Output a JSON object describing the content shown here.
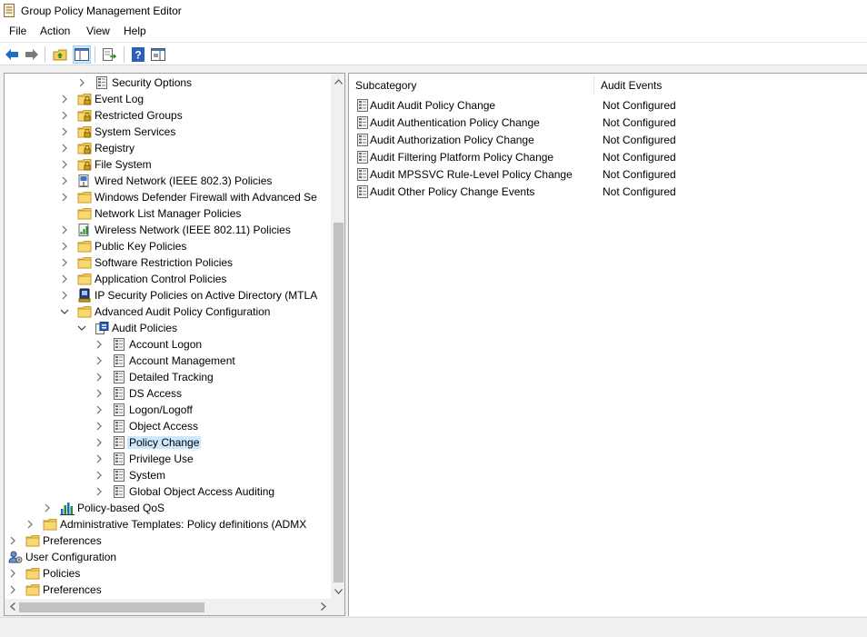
{
  "window": {
    "title": "Group Policy Management Editor"
  },
  "menu": [
    "File",
    "Action",
    "View",
    "Help"
  ],
  "toolbar": {
    "buttons": [
      "back-icon",
      "forward-icon",
      "up-folder-icon",
      "show-hide-tree-icon",
      "export-list-icon",
      "help-icon",
      "properties-pane-icon"
    ]
  },
  "tree": {
    "items": [
      {
        "label": "Security Options",
        "icon": "policy-doc-icon",
        "indent": 4,
        "expander": "collapsed"
      },
      {
        "label": "Event Log",
        "icon": "folder-lock-icon",
        "indent": 3,
        "expander": "collapsed"
      },
      {
        "label": "Restricted Groups",
        "icon": "folder-lock-icon",
        "indent": 3,
        "expander": "collapsed"
      },
      {
        "label": "System Services",
        "icon": "folder-lock-icon",
        "indent": 3,
        "expander": "collapsed"
      },
      {
        "label": "Registry",
        "icon": "folder-lock-icon",
        "indent": 3,
        "expander": "collapsed"
      },
      {
        "label": "File System",
        "icon": "folder-lock-icon",
        "indent": 3,
        "expander": "collapsed"
      },
      {
        "label": "Wired Network (IEEE 802.3) Policies",
        "icon": "wired-network-icon",
        "indent": 3,
        "expander": "collapsed"
      },
      {
        "label": "Windows Defender Firewall with Advanced Se",
        "icon": "folder-icon",
        "indent": 3,
        "expander": "collapsed"
      },
      {
        "label": "Network List Manager Policies",
        "icon": "folder-icon",
        "indent": 3,
        "expander": "none"
      },
      {
        "label": "Wireless Network (IEEE 802.11) Policies",
        "icon": "wireless-network-icon",
        "indent": 3,
        "expander": "collapsed"
      },
      {
        "label": "Public Key Policies",
        "icon": "folder-icon",
        "indent": 3,
        "expander": "collapsed"
      },
      {
        "label": "Software Restriction Policies",
        "icon": "folder-icon",
        "indent": 3,
        "expander": "collapsed"
      },
      {
        "label": "Application Control Policies",
        "icon": "folder-icon",
        "indent": 3,
        "expander": "collapsed"
      },
      {
        "label": "IP Security Policies on Active Directory (MTLA",
        "icon": "ip-security-icon",
        "indent": 3,
        "expander": "collapsed"
      },
      {
        "label": "Advanced Audit Policy Configuration",
        "icon": "folder-icon",
        "indent": 3,
        "expander": "expanded"
      },
      {
        "label": "Audit Policies",
        "icon": "audit-policies-icon",
        "indent": 4,
        "expander": "expanded"
      },
      {
        "label": "Account Logon",
        "icon": "policy-doc-icon",
        "indent": 5,
        "expander": "collapsed"
      },
      {
        "label": "Account Management",
        "icon": "policy-doc-icon",
        "indent": 5,
        "expander": "collapsed"
      },
      {
        "label": "Detailed Tracking",
        "icon": "policy-doc-icon",
        "indent": 5,
        "expander": "collapsed"
      },
      {
        "label": "DS Access",
        "icon": "policy-doc-icon",
        "indent": 5,
        "expander": "collapsed"
      },
      {
        "label": "Logon/Logoff",
        "icon": "policy-doc-icon",
        "indent": 5,
        "expander": "collapsed"
      },
      {
        "label": "Object Access",
        "icon": "policy-doc-icon",
        "indent": 5,
        "expander": "collapsed"
      },
      {
        "label": "Policy Change",
        "icon": "policy-doc-icon",
        "indent": 5,
        "expander": "collapsed",
        "selected": true
      },
      {
        "label": "Privilege Use",
        "icon": "policy-doc-icon",
        "indent": 5,
        "expander": "collapsed"
      },
      {
        "label": "System",
        "icon": "policy-doc-icon",
        "indent": 5,
        "expander": "collapsed"
      },
      {
        "label": "Global Object Access Auditing",
        "icon": "policy-doc-icon",
        "indent": 5,
        "expander": "collapsed"
      },
      {
        "label": "Policy-based QoS",
        "icon": "qos-chart-icon",
        "indent": 2,
        "expander": "collapsed"
      },
      {
        "label": "Administrative Templates: Policy definitions (ADMX",
        "icon": "folder-icon",
        "indent": 1,
        "expander": "collapsed"
      },
      {
        "label": "Preferences",
        "icon": "folder-icon",
        "indent": 0,
        "expander": "collapsed"
      },
      {
        "label": "User Configuration",
        "icon": "user-config-icon",
        "indent": -1,
        "expander": "expanded"
      },
      {
        "label": "Policies",
        "icon": "folder-icon",
        "indent": 0,
        "expander": "collapsed"
      },
      {
        "label": "Preferences",
        "icon": "folder-icon",
        "indent": 0,
        "expander": "collapsed"
      }
    ]
  },
  "list": {
    "columns": [
      "Subcategory",
      "Audit Events"
    ],
    "rows": [
      {
        "name": "Audit Audit Policy Change",
        "value": "Not Configured"
      },
      {
        "name": "Audit Authentication Policy Change",
        "value": "Not Configured"
      },
      {
        "name": "Audit Authorization Policy Change",
        "value": "Not Configured"
      },
      {
        "name": "Audit Filtering Platform Policy Change",
        "value": "Not Configured"
      },
      {
        "name": "Audit MPSSVC Rule-Level Policy Change",
        "value": "Not Configured"
      },
      {
        "name": "Audit Other Policy Change Events",
        "value": "Not Configured"
      }
    ]
  },
  "colors": {
    "selection": "#cce8ff",
    "folder": "#f5cf59",
    "accent": "#1e6ec8"
  }
}
